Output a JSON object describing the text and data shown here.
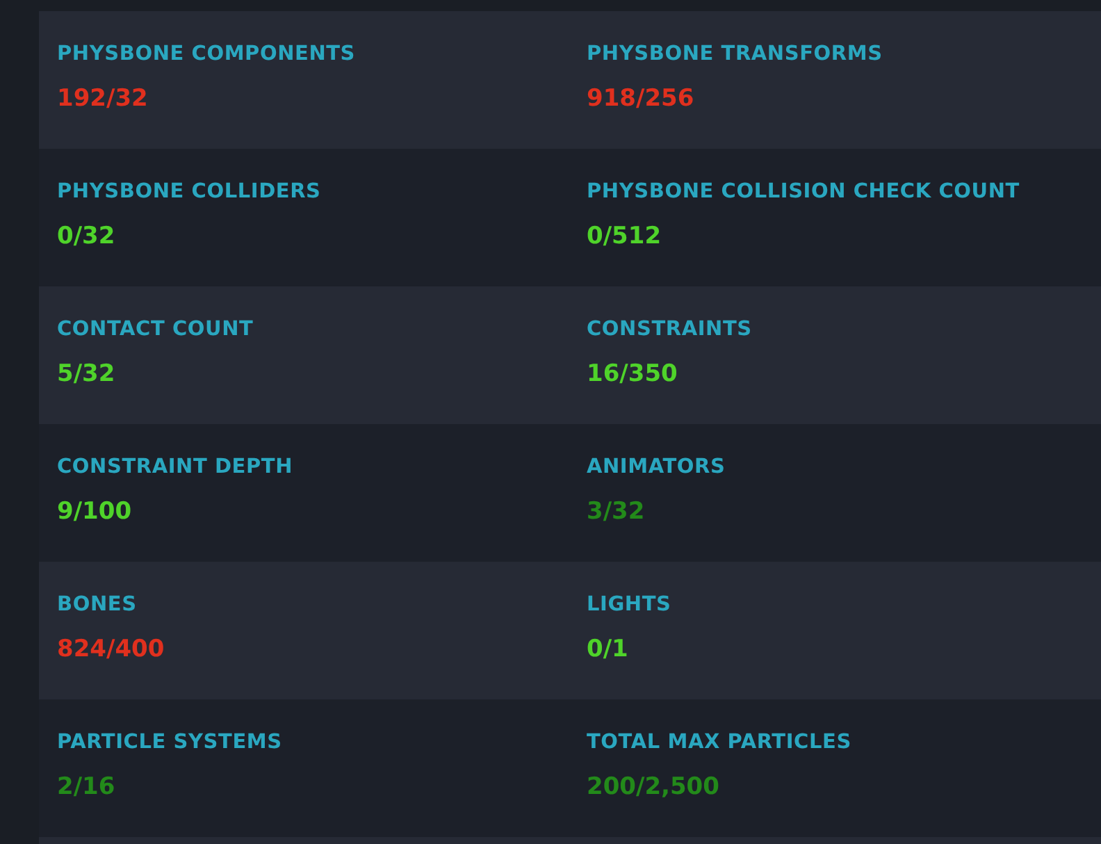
{
  "rows": [
    {
      "stats": [
        {
          "label": "PHYSBONE COMPONENTS",
          "value": "192/32",
          "color": "#e0301e"
        },
        {
          "label": "PHYSBONE TRANSFORMS",
          "value": "918/256",
          "color": "#e0301e"
        }
      ]
    },
    {
      "stats": [
        {
          "label": "PHYSBONE COLLIDERS",
          "value": "0/32",
          "color": "#4fd32a"
        },
        {
          "label": "PHYSBONE COLLISION CHECK COUNT",
          "value": "0/512",
          "color": "#4fd32a"
        }
      ]
    },
    {
      "stats": [
        {
          "label": "CONTACT COUNT",
          "value": "5/32",
          "color": "#4fd32a"
        },
        {
          "label": "CONSTRAINTS",
          "value": "16/350",
          "color": "#4fd32a"
        }
      ]
    },
    {
      "stats": [
        {
          "label": "CONSTRAINT DEPTH",
          "value": "9/100",
          "color": "#4fd32a"
        },
        {
          "label": "ANIMATORS",
          "value": "3/32",
          "color": "#238a1a"
        }
      ]
    },
    {
      "stats": [
        {
          "label": "BONES",
          "value": "824/400",
          "color": "#e0301e"
        },
        {
          "label": "LIGHTS",
          "value": "0/1",
          "color": "#4fd32a"
        }
      ]
    },
    {
      "stats": [
        {
          "label": "PARTICLE SYSTEMS",
          "value": "2/16",
          "color": "#238a1a"
        },
        {
          "label": "TOTAL MAX PARTICLES",
          "value": "200/2,500",
          "color": "#238a1a"
        }
      ]
    }
  ]
}
